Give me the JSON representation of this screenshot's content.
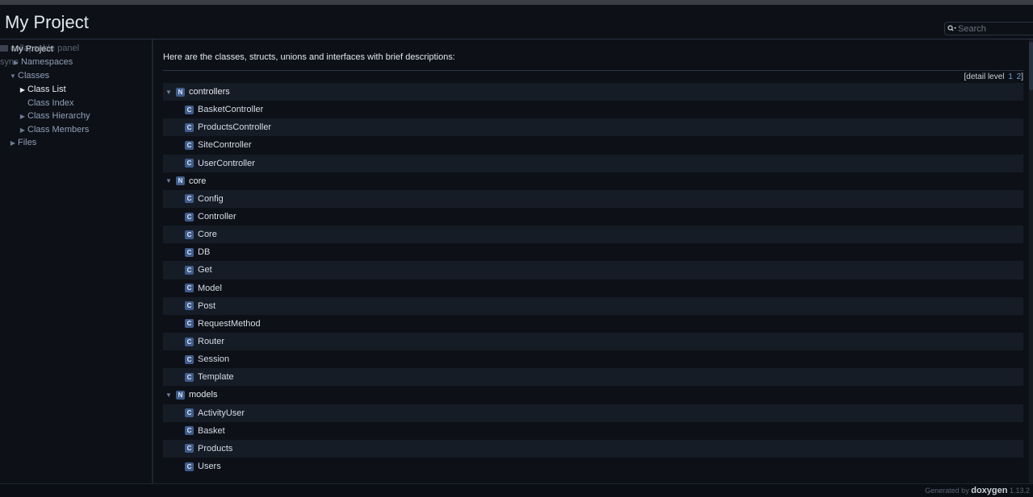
{
  "header": {
    "title": "My Project",
    "search_placeholder": "Search"
  },
  "sidebar": {
    "ghost_text_1": "collapsable panel",
    "ghost_text_2": "sync",
    "items": [
      {
        "label": "My Project"
      },
      {
        "label": "Namespaces"
      },
      {
        "label": "Classes"
      },
      {
        "label": "Class List"
      },
      {
        "label": "Class Index"
      },
      {
        "label": "Class Hierarchy"
      },
      {
        "label": "Class Members"
      },
      {
        "label": "Files"
      }
    ]
  },
  "main": {
    "intro": "Here are the classes, structs, unions and interfaces with brief descriptions:",
    "detail_level_label": "[detail level",
    "detail_level_1": "1",
    "detail_level_2": "2",
    "detail_level_close": "]",
    "namespace_badge": "N",
    "class_badge": "C",
    "rows": [
      {
        "kind": "ns",
        "label": "controllers"
      },
      {
        "kind": "cls",
        "label": "BasketController"
      },
      {
        "kind": "cls",
        "label": "ProductsController"
      },
      {
        "kind": "cls",
        "label": "SiteController"
      },
      {
        "kind": "cls",
        "label": "UserController"
      },
      {
        "kind": "ns",
        "label": "core"
      },
      {
        "kind": "cls",
        "label": "Config"
      },
      {
        "kind": "cls",
        "label": "Controller"
      },
      {
        "kind": "cls",
        "label": "Core"
      },
      {
        "kind": "cls",
        "label": "DB"
      },
      {
        "kind": "cls",
        "label": "Get"
      },
      {
        "kind": "cls",
        "label": "Model"
      },
      {
        "kind": "cls",
        "label": "Post"
      },
      {
        "kind": "cls",
        "label": "RequestMethod"
      },
      {
        "kind": "cls",
        "label": "Router"
      },
      {
        "kind": "cls",
        "label": "Session"
      },
      {
        "kind": "cls",
        "label": "Template"
      },
      {
        "kind": "ns",
        "label": "models"
      },
      {
        "kind": "cls",
        "label": "ActivityUser"
      },
      {
        "kind": "cls",
        "label": "Basket"
      },
      {
        "kind": "cls",
        "label": "Products"
      },
      {
        "kind": "cls",
        "label": "Users"
      }
    ]
  },
  "footer": {
    "generated_by": "Generated by",
    "logo": "doxygen",
    "version": "1.13.2"
  }
}
